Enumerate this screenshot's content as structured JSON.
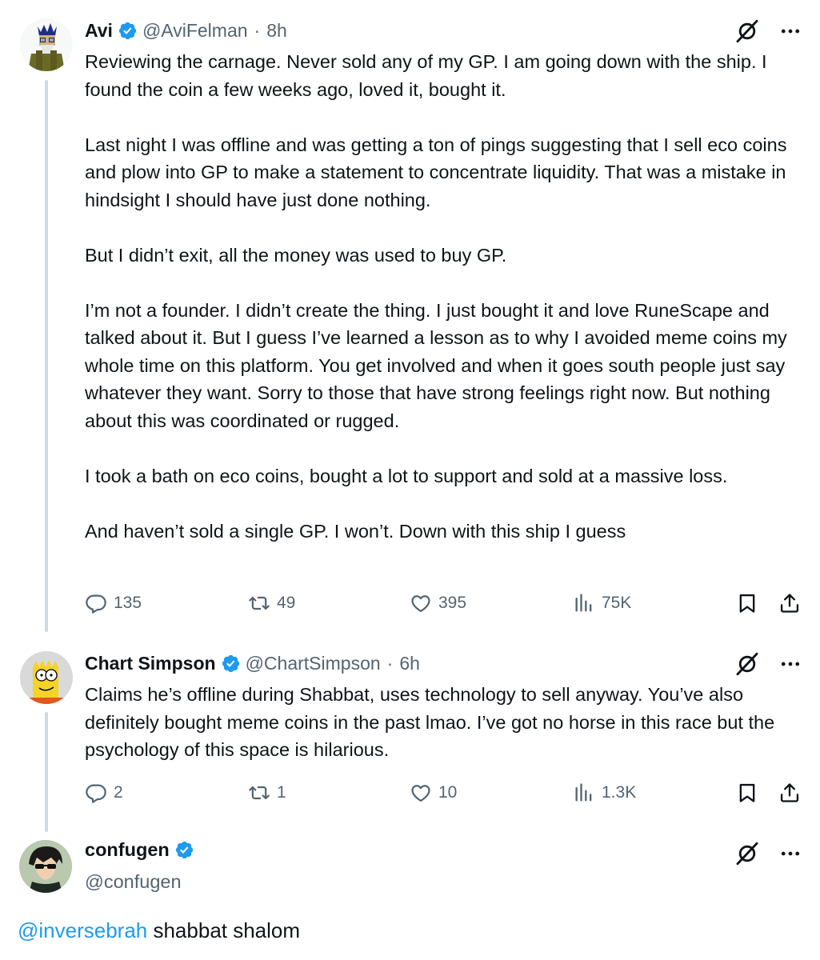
{
  "colors": {
    "accent": "#1d9bf0",
    "text": "#0f1419",
    "muted": "#536471",
    "thread_line": "#cfd9de"
  },
  "tweets": [
    {
      "name": "Avi",
      "handle": "@AviFelman",
      "dot": "·",
      "time": "8h",
      "avatar_icon": "avatar-pixel-wizard",
      "text": "Reviewing the carnage. Never sold any of my GP. I am going down with the ship. I found the coin a few weeks ago, loved it, bought it.\n\nLast night I was offline and was getting a ton of pings suggesting that I sell eco coins and plow into GP to make a statement to concentrate liquidity. That was a mistake in hindsight I should have just done nothing.\n\nBut I didn’t exit, all the money was used to buy GP.\n\nI’m not a founder. I didn’t create the thing. I just bought it and love RuneScape and talked about it. But I guess I’ve learned a lesson as to why I avoided meme coins my whole time on this platform. You get involved and when it goes south people just say whatever they want. Sorry to those that have strong feelings right now. But nothing about this was coordinated or rugged.\n\nI took a bath on eco coins, bought a lot to support and sold at a massive loss.\n\nAnd haven’t sold a single GP. I won’t. Down with this ship I guess",
      "replies": "135",
      "reposts": "49",
      "likes": "395",
      "views": "75K"
    },
    {
      "name": "Chart Simpson",
      "handle": "@ChartSimpson",
      "dot": "·",
      "time": "6h",
      "avatar_icon": "avatar-bart-simpson",
      "text": "Claims he’s offline during Shabbat, uses technology to sell anyway. You’ve also definitely bought meme coins in the past lmao. I’ve got no horse in this race but the psychology of this space is hilarious.",
      "replies": "2",
      "reposts": "1",
      "likes": "10",
      "views": "1.3K"
    },
    {
      "name": "confugen",
      "handle": "@confugen",
      "avatar_icon": "avatar-anime-sunglasses",
      "mention": "@inversebrah",
      "text": " shabbat shalom"
    }
  ],
  "icons": [
    "verified-badge-icon",
    "grok-icon",
    "more-icon",
    "reply-icon",
    "repost-icon",
    "like-icon",
    "views-icon",
    "bookmark-icon",
    "share-icon"
  ]
}
